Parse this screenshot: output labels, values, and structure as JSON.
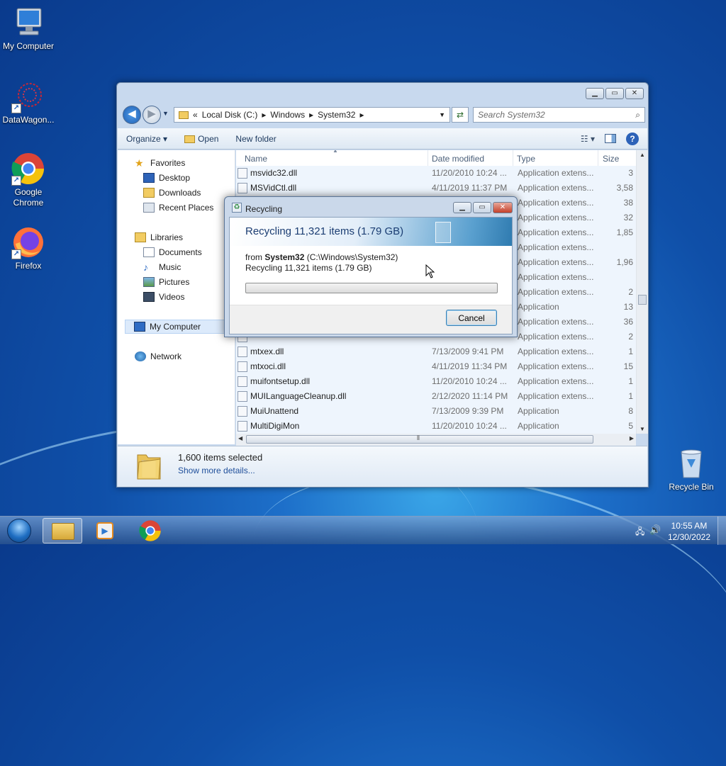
{
  "desktop": {
    "icons": [
      {
        "label": "My Computer"
      },
      {
        "label": "DataWagon..."
      },
      {
        "label": "Google\nChrome"
      },
      {
        "label": "Firefox"
      },
      {
        "label": "Recycle Bin"
      }
    ]
  },
  "explorer": {
    "nav_back": "◀",
    "address_prefix": "«",
    "address": [
      "Local Disk (C:)",
      "Windows",
      "System32"
    ],
    "address_sep": "▸",
    "search_placeholder": "Search System32",
    "toolbar": {
      "organize": "Organize ▾",
      "open": "Open",
      "new_folder": "New folder"
    },
    "nav": {
      "favorites": "Favorites",
      "desktop": "Desktop",
      "downloads": "Downloads",
      "recent_places": "Recent Places",
      "libraries": "Libraries",
      "documents": "Documents",
      "music": "Music",
      "pictures": "Pictures",
      "videos": "Videos",
      "my_computer": "My Computer",
      "network": "Network"
    },
    "columns": {
      "name": "Name",
      "date": "Date modified",
      "type": "Type",
      "size": "Size"
    },
    "rows": [
      {
        "name": "msvidc32.dll",
        "date": "11/20/2010 10:24 ...",
        "type": "Application extens...",
        "size": "3"
      },
      {
        "name": "MSVidCtl.dll",
        "date": "4/11/2019 11:37 PM",
        "type": "Application extens...",
        "size": "3,58"
      },
      {
        "name": "",
        "date": "",
        "type": "Application extens...",
        "size": "38"
      },
      {
        "name": "",
        "date": "",
        "type": "Application extens...",
        "size": "32"
      },
      {
        "name": "",
        "date": "",
        "type": "Application extens...",
        "size": "1,85"
      },
      {
        "name": "",
        "date": "",
        "type": "Application extens...",
        "size": ""
      },
      {
        "name": "",
        "date": "",
        "type": "Application extens...",
        "size": "1,96"
      },
      {
        "name": "",
        "date": "",
        "type": "Application extens...",
        "size": ""
      },
      {
        "name": "",
        "date": "",
        "type": "Application extens...",
        "size": "2"
      },
      {
        "name": "",
        "date": "",
        "type": "Application",
        "size": "13"
      },
      {
        "name": "",
        "date": "",
        "type": "Application extens...",
        "size": "36"
      },
      {
        "name": "",
        "date": "",
        "type": "Application extens...",
        "size": "2"
      },
      {
        "name": "mtxex.dll",
        "date": "7/13/2009 9:41 PM",
        "type": "Application extens...",
        "size": "1"
      },
      {
        "name": "mtxoci.dll",
        "date": "4/11/2019 11:34 PM",
        "type": "Application extens...",
        "size": "15"
      },
      {
        "name": "muifontsetup.dll",
        "date": "11/20/2010 10:24 ...",
        "type": "Application extens...",
        "size": "1"
      },
      {
        "name": "MUILanguageCleanup.dll",
        "date": "2/12/2020 11:14 PM",
        "type": "Application extens...",
        "size": "1"
      },
      {
        "name": "MuiUnattend",
        "date": "7/13/2009 9:39 PM",
        "type": "Application",
        "size": "8"
      },
      {
        "name": "MultiDigiMon",
        "date": "11/20/2010 10:24 ...",
        "type": "Application",
        "size": "5"
      }
    ],
    "status": {
      "count": "1,600 items selected",
      "more": "Show more details..."
    }
  },
  "dialog": {
    "title": "Recycling",
    "heading": "Recycling 11,321 items (1.79 GB)",
    "from_label": "from ",
    "from_bold": "System32",
    "from_path": " (C:\\Windows\\System32)",
    "line2": "Recycling 11,321 items (1.79 GB)",
    "progress": 0,
    "cancel": "Cancel"
  },
  "taskbar": {
    "time": "10:55 AM",
    "date": "12/30/2022"
  }
}
